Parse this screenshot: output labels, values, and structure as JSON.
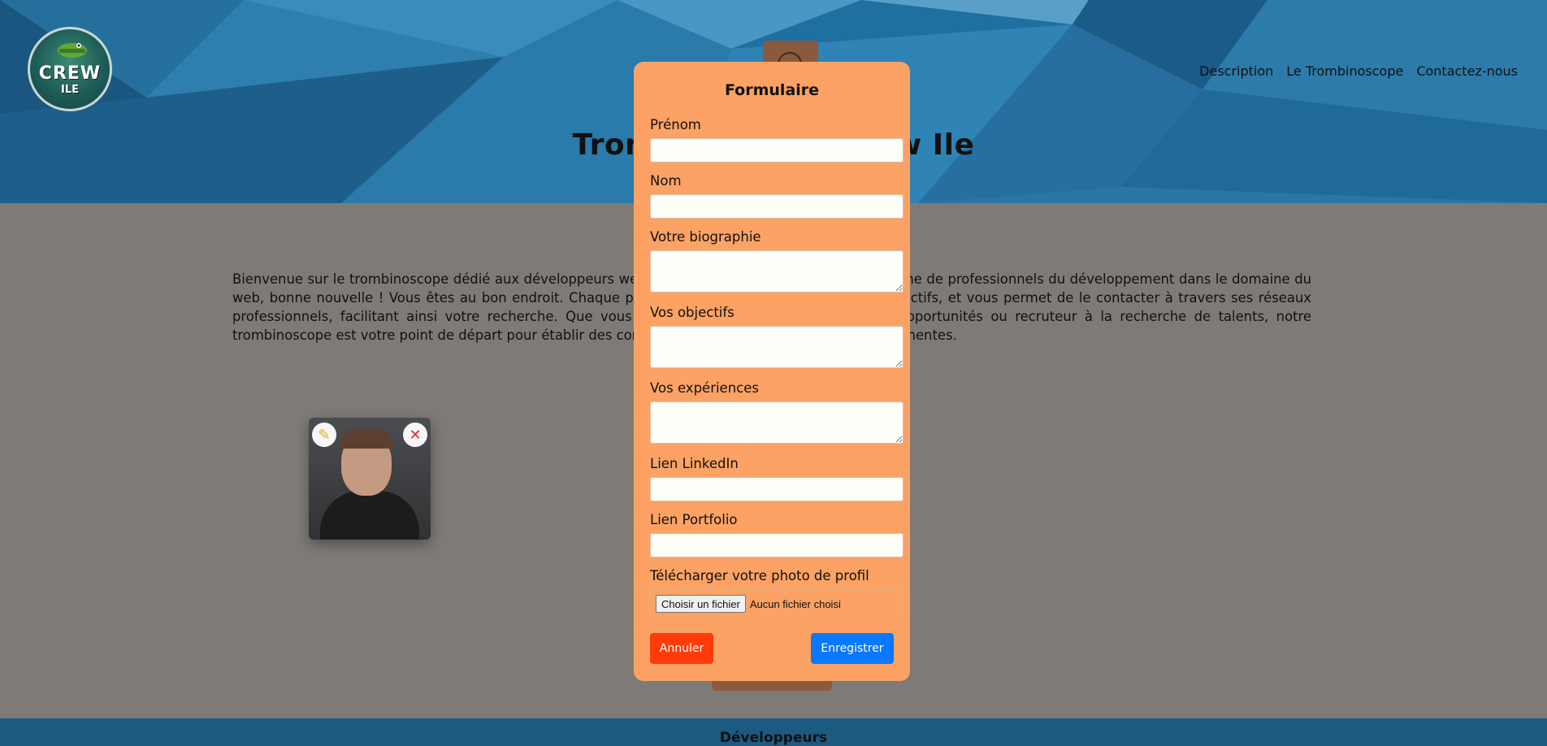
{
  "header": {
    "logo": {
      "line1": "CREW",
      "line2": "ILE"
    },
    "nav": [
      "Description",
      "Le Trombinoscope",
      "Contactez-nous"
    ],
    "title": "Trombinoscope Crew Ile",
    "add_icon": "add-user-icon"
  },
  "intro": {
    "text": "Bienvenue sur le trombinoscope dédié aux développeurs web du Crew Ile ! Si vous êtes à la recherche de professionnels du développement dans le domaine du web, bonne nouvelle ! Vous êtes au bon endroit. Chaque profil présente ses compétences, ses objectifs, et vous permet de le contacter à travers ses réseaux professionnels, facilitant ainsi votre recherche. Que vous soyez développeur à la recherche d'opportunités ou recruteur à la recherche de talents, notre trombinoscope est votre point de départ pour établir des connexions professionnelles solides et pertinentes."
  },
  "card": {
    "edit_icon": "pencil-icon",
    "delete_icon": "close-icon"
  },
  "modal": {
    "title": "Formulaire",
    "fields": {
      "prenom": "Prénom",
      "nom": "Nom",
      "bio": "Votre biographie",
      "objectifs": "Vos objectifs",
      "experiences": "Vos expériences",
      "linkedin": "Lien LinkedIn",
      "portfolio": "Lien Portfolio",
      "photo": "Télécharger votre photo de profil"
    },
    "file_button": "Choisir un fichier",
    "file_status": "Aucun fichier choisi",
    "cancel": "Annuler",
    "save": "Enregistrer"
  },
  "footer": {
    "title": "Développeurs"
  },
  "colors": {
    "modal_bg": "#fba264",
    "cancel": "#ff3b0a",
    "save": "#0a78ff",
    "header": "#1f6fa1"
  }
}
